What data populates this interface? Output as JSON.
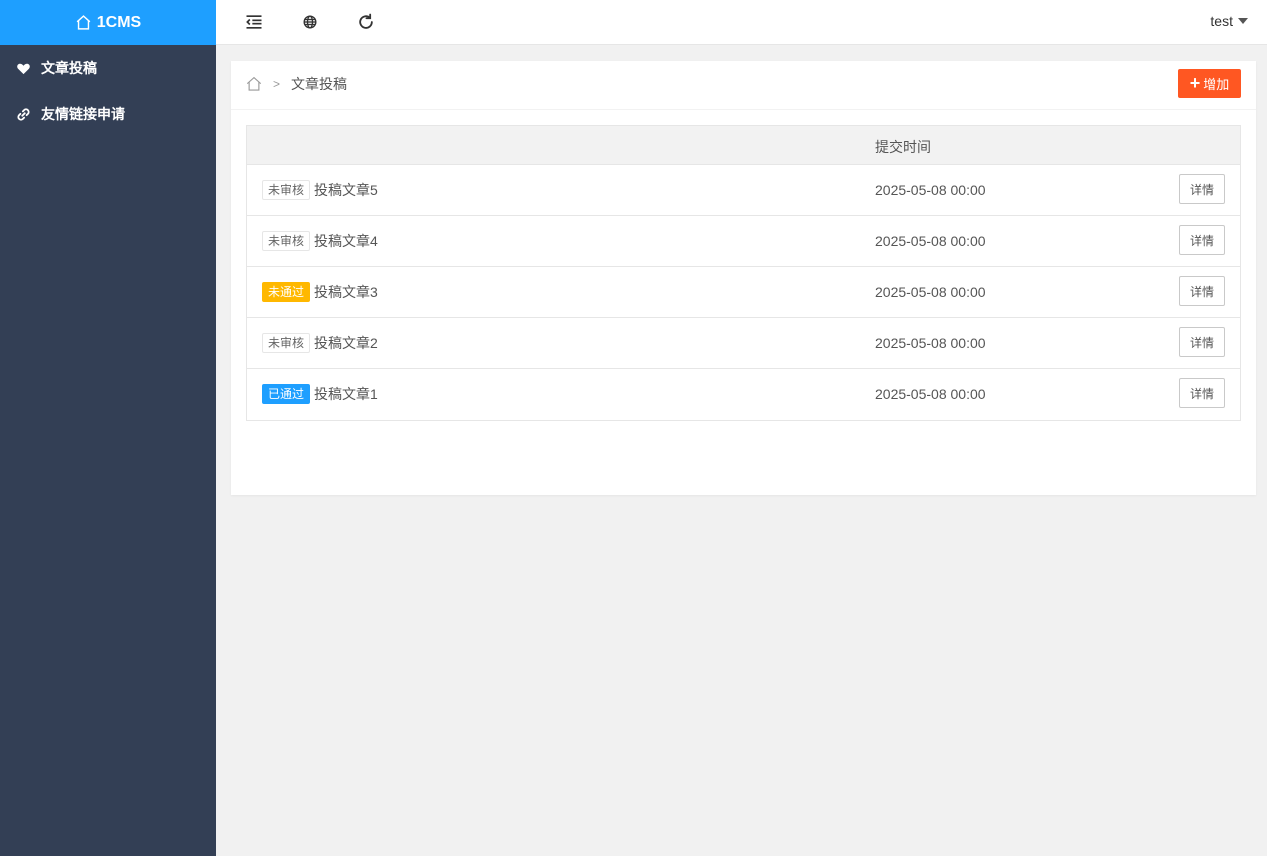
{
  "app": {
    "logo_text": "1CMS"
  },
  "sidebar": {
    "items": [
      {
        "label": "文章投稿",
        "icon": "heart-icon"
      },
      {
        "label": "友情链接申请",
        "icon": "link-icon"
      }
    ]
  },
  "topbar": {
    "icons": [
      "menu-collapse-icon",
      "globe-icon",
      "refresh-icon"
    ],
    "user": "test"
  },
  "breadcrumb": {
    "current": "文章投稿",
    "separator": ">"
  },
  "toolbar": {
    "add_label": "增加"
  },
  "table": {
    "columns": [
      "",
      "提交时间",
      ""
    ],
    "rows": [
      {
        "status": "未审核",
        "status_type": "pending",
        "title": "投稿文章5",
        "time": "2025-05-08 00:00",
        "action": "详情"
      },
      {
        "status": "未审核",
        "status_type": "pending",
        "title": "投稿文章4",
        "time": "2025-05-08 00:00",
        "action": "详情"
      },
      {
        "status": "未通过",
        "status_type": "rejected",
        "title": "投稿文章3",
        "time": "2025-05-08 00:00",
        "action": "详情"
      },
      {
        "status": "未审核",
        "status_type": "pending",
        "title": "投稿文章2",
        "time": "2025-05-08 00:00",
        "action": "详情"
      },
      {
        "status": "已通过",
        "status_type": "approved",
        "title": "投稿文章1",
        "time": "2025-05-08 00:00",
        "action": "详情"
      }
    ]
  },
  "colors": {
    "sidebar_bg": "#333f55",
    "brand": "#1e9fff",
    "add_button": "#ff5722",
    "rejected": "#ffb800",
    "approved": "#1e9fff"
  }
}
